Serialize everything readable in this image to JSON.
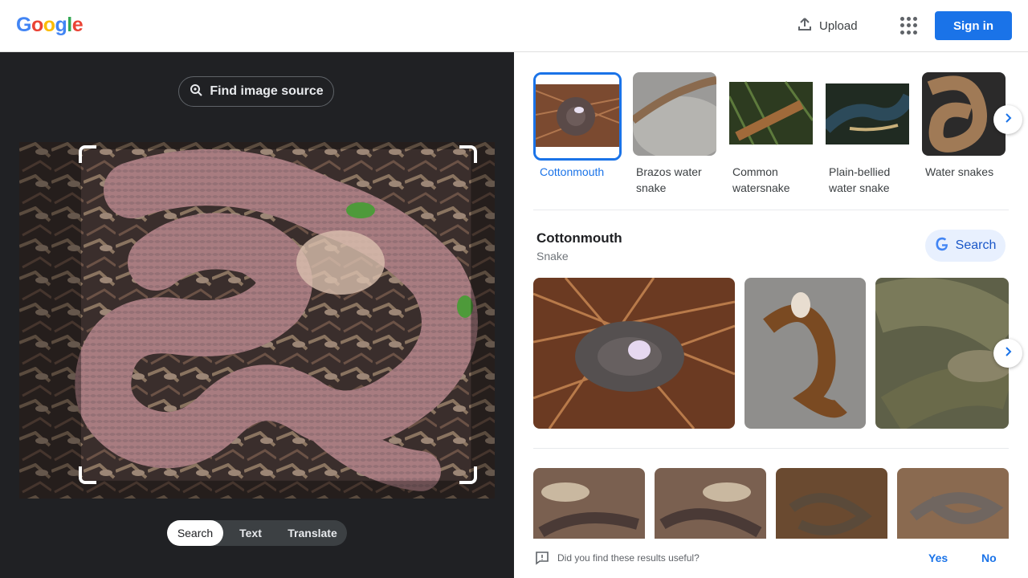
{
  "header": {
    "logo_letters": [
      "G",
      "o",
      "o",
      "g",
      "l",
      "e"
    ],
    "logo_colors": [
      "#4285f4",
      "#ea4335",
      "#fbbc05",
      "#4285f4",
      "#34a853",
      "#ea4335"
    ],
    "upload_label": "Upload",
    "sign_in_label": "Sign in"
  },
  "lens": {
    "find_image_source_label": "Find image source",
    "modes": [
      "Search",
      "Text",
      "Translate"
    ],
    "active_mode": "Search"
  },
  "related": {
    "items": [
      {
        "label": "Cottonmouth",
        "selected": true
      },
      {
        "label": "Brazos water snake",
        "selected": false
      },
      {
        "label": "Common watersnake",
        "selected": false
      },
      {
        "label": "Plain-bellied water snake",
        "selected": false
      },
      {
        "label": "Water snakes",
        "selected": false
      }
    ]
  },
  "entity": {
    "title": "Cottonmouth",
    "subtitle": "Snake",
    "search_label": "Search"
  },
  "feedback": {
    "question": "Did you find these results useful?",
    "yes_label": "Yes",
    "no_label": "No"
  },
  "colors": {
    "accent": "#1a73e8",
    "dark_pane": "#202124"
  }
}
